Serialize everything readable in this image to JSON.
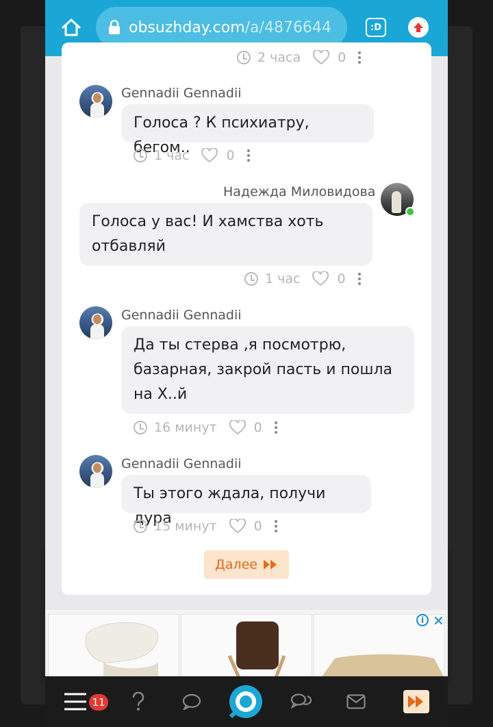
{
  "browser": {
    "url_host": "obsuzhday.com",
    "url_path": "/a/4876644",
    "tab_label": ":D"
  },
  "thread": {
    "prev_meta": {
      "time": "2 часа",
      "likes": "0"
    },
    "comments": [
      {
        "author": "Gennadii Gennadii",
        "text": "Голоса ? К психиатру, бегом..",
        "time": "1 час",
        "likes": "0",
        "side": "left"
      },
      {
        "author": "Надежда Миловидова",
        "text": "Голоса у вас! И хамства хоть отбавляй",
        "time": "1 час",
        "likes": "0",
        "side": "right"
      },
      {
        "author": "Gennadii Gennadii",
        "text": "Да ты стерва ,я посмотрю, базарная, закрой пасть и пошла на Х..й",
        "time": "16 минут",
        "likes": "0",
        "side": "left"
      },
      {
        "author": "Gennadii Gennadii",
        "text": "Ты этого ждала, получи дура",
        "time": "15 минут",
        "likes": "0",
        "side": "left"
      }
    ],
    "more_label": "Далее"
  },
  "ads": {
    "info_icon": "info-icon",
    "close_icon": "close-icon"
  },
  "bottom_nav": {
    "badge_count": "11",
    "items": [
      "menu-icon",
      "question-icon",
      "chat-bubble-icon",
      "home-logo",
      "messages-icon",
      "mail-icon",
      "fast-forward-icon"
    ]
  },
  "colors": {
    "topbar": "#1aa7d6",
    "accent_orange": "#e06b1a",
    "badge_red": "#e53935"
  }
}
